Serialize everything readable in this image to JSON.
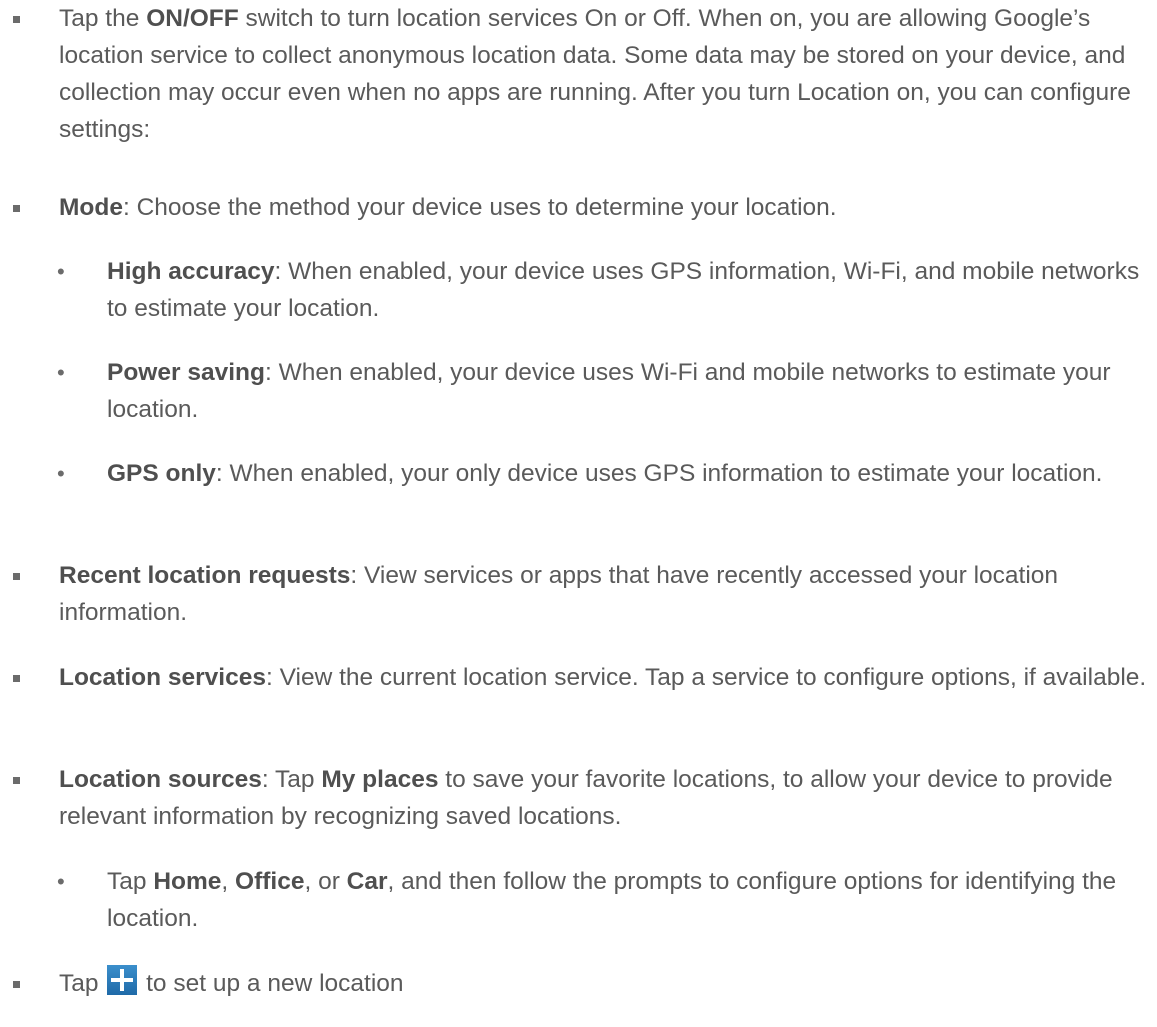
{
  "items": [
    {
      "prefix": "Tap the ",
      "bold": "ON/OFF",
      "rest": " switch to turn location services On or Off. When on, you are allowing Google’s location service to collect anonymous location data. Some data may be stored on your device, and collection may occur even when no apps are running. After you turn Location on, you can configure settings:"
    },
    {
      "bold": "Mode",
      "rest": ": Choose the method your device uses to determine your location."
    },
    {
      "bold": "High accuracy",
      "rest": ": When enabled, your device uses GPS information, Wi-Fi, and mobile networks to estimate your location."
    },
    {
      "bold": "Power saving",
      "rest": ": When enabled, your device uses Wi-Fi and mobile networks to estimate your location."
    },
    {
      "bold": "GPS only",
      "rest": ": When enabled, your only device uses GPS information to estimate your location."
    },
    {
      "bold": "Recent location requests",
      "rest": ": View services or apps that have recently accessed your location information."
    },
    {
      "bold": "Location services",
      "rest": ": View the current location service. Tap a service to configure options, if available."
    },
    {
      "bold": "Location sources",
      "mid": ": Tap ",
      "bold2": "My places",
      "rest": " to save your favorite locations, to allow your device to provide relevant information by recognizing saved locations."
    },
    {
      "prefix": "Tap ",
      "bold": "Home",
      "sep1": ", ",
      "bold2": "Office",
      "sep2": ", or ",
      "bold3": "Car",
      "rest": ", and then follow the prompts to configure options for identifying the location."
    },
    {
      "prefix": "Tap ",
      "rest": " to set up a new location"
    }
  ],
  "icons": {
    "plus": "plus-icon"
  },
  "colors": {
    "text": "#5a5a5a",
    "icon_blue": "#2a7abf"
  }
}
